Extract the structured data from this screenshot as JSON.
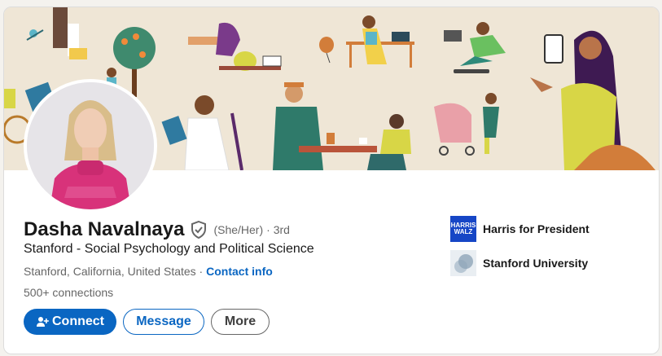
{
  "profile": {
    "name": "Dasha Navalnaya",
    "pronouns": "(She/Her)",
    "degree": "· 3rd",
    "headline": "Stanford - Social Psychology and Political Science",
    "location": "Stanford, California, United States",
    "location_separator": " · ",
    "contact_label": "Contact info",
    "connections": "500+ connections"
  },
  "actions": {
    "connect_label": "Connect",
    "message_label": "Message",
    "more_label": "More"
  },
  "organizations": [
    {
      "name": "Harris for President",
      "logo_text_line1": "HARRIS",
      "logo_text_line2": "WALZ"
    },
    {
      "name": "Stanford University"
    }
  ],
  "colors": {
    "brand_blue": "#0a66c2",
    "banner_bg": "#efe6d6",
    "text_primary": "#191919",
    "text_secondary": "#666666"
  },
  "icons": {
    "verified": "shield-check-icon",
    "connect": "person-add-icon"
  }
}
